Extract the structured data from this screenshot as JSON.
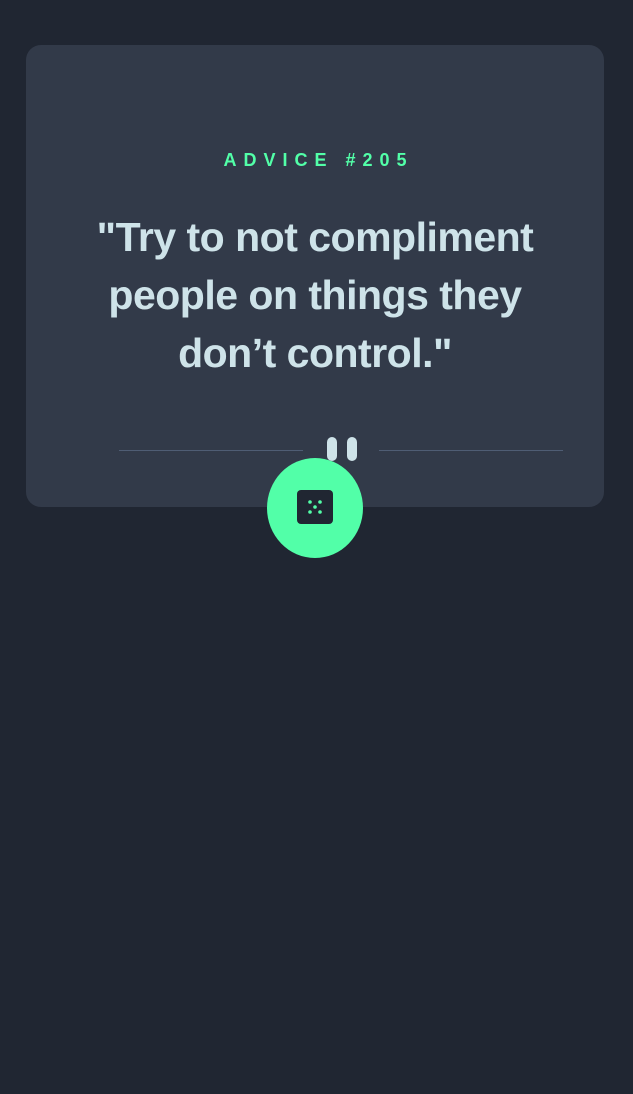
{
  "card": {
    "advice_id": "ADVICE #205",
    "quote": "\"Try to not compliment people on things they don’t control.\""
  },
  "divider": {
    "icon": "pause-icon"
  },
  "dice_button": {
    "icon": "dice-icon"
  },
  "colors": {
    "background": "#202632",
    "card": "#323a49",
    "accent": "#52ffa8",
    "text": "#cee3e9",
    "divider": "#4f5d74"
  }
}
